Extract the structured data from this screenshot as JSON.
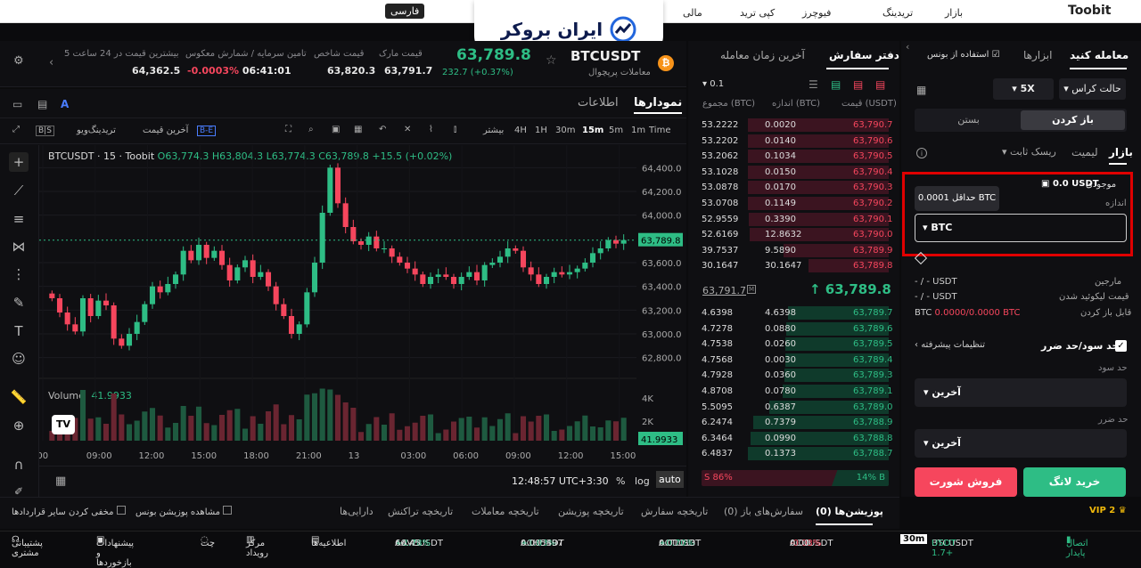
{
  "topnav": {
    "items": [
      "Toobit",
      "بازار",
      "تریدینگ",
      "فیوچرز",
      "کپی ترید",
      "مالی",
      "تبادل"
    ],
    "lang_badge": "فارسی"
  },
  "brand": {
    "name": "ایران بروکر"
  },
  "ticker": {
    "symbol": "BTCUSDT",
    "subtitle": "معاملات پرپچوال",
    "price": "63,789.8",
    "change": "232.7 (+0.37%)",
    "mark_label": "قیمت مارک",
    "mark_value": "63,791.7",
    "index_label": "قیمت شاخص",
    "index_value": "63,820.3",
    "funding_label": "تامین سرمایه / شمارش معکوس",
    "funding_rate": "-0.0003%",
    "funding_time": "06:41:01",
    "high_label": "بیشترین قیمت در 24 ساعت 5",
    "high_value": "64,362.5"
  },
  "chart_tabs": {
    "charts": "نمودارها",
    "info": "اطلاعات"
  },
  "chart_toolbar": {
    "timeframes": [
      "Time",
      "1m",
      "5m",
      "15m",
      "30m",
      "1H",
      "4H"
    ],
    "more": "بیشتر",
    "last_price": "آخرین قیمت",
    "tradingview": "تریدینگ‌ویو",
    "bs": "B|S",
    "be": "B-E"
  },
  "chart_legend": {
    "title": "BTCUSDT · 15 · Toobit",
    "o": "O63,774.3",
    "h": "H63,804.3",
    "l": "L63,774.3",
    "c": "C63,789.8",
    "chg": "+15.5 (+0.02%)",
    "volume_label": "Volume",
    "volume_value": "41.9933"
  },
  "chart_data": {
    "type": "candlestick",
    "y_ticks": [
      "64,400.0",
      "64,200.0",
      "64,000.0",
      "63,600.0",
      "63,400.0",
      "63,200.0",
      "63,000.0",
      "62,800.0"
    ],
    "x_ticks": [
      ":00",
      "09:00",
      "12:00",
      "15:00",
      "18:00",
      "21:00",
      "13",
      "03:00",
      "06:00",
      "09:00",
      "12:00",
      "15:00"
    ],
    "vol_ticks": [
      "4K",
      "2K"
    ],
    "last_price_tag": "63,789.8",
    "last_volume_tag": "41.9933",
    "closes": [
      63300,
      63180,
      63080,
      63020,
      63300,
      63150,
      63280,
      63240,
      62960,
      62900,
      63000,
      63100,
      63250,
      63400,
      63350,
      63420,
      63500,
      63700,
      63620,
      63750,
      63640,
      63700,
      63580,
      63450,
      63560,
      63620,
      63480,
      63520,
      63400,
      63250,
      63150,
      63000,
      63080,
      63350,
      63600,
      64020,
      64400,
      64100,
      63900,
      63780,
      63750,
      63820,
      63720,
      63720,
      63650,
      63600,
      63550,
      63500,
      63420,
      63480,
      63500,
      63480,
      63420,
      63480,
      63520,
      63450,
      63580,
      63600,
      63650,
      63720,
      63700,
      63560,
      63500,
      63420,
      63480,
      63520,
      63500,
      63520,
      63550,
      63600,
      63680,
      63720,
      63790,
      63760,
      63790
    ]
  },
  "chart_footer": {
    "clock": "12:48:57 UTC+3:30",
    "pct": "%",
    "log": "log",
    "auto": "auto"
  },
  "orderbook": {
    "tab_orderbook": "دفتر سفارش",
    "tab_trades": "آخرین زمان معامله",
    "precision": "0.1",
    "col_price": "قیمت (USDT)",
    "col_size": "اندازه (BTC)",
    "col_total": "مجموع (BTC)",
    "asks": [
      [
        "63,790.7",
        "0.0020",
        "53.2222"
      ],
      [
        "63,790.6",
        "0.0140",
        "53.2202"
      ],
      [
        "63,790.5",
        "0.1034",
        "53.2062"
      ],
      [
        "63,790.4",
        "0.0150",
        "53.1028"
      ],
      [
        "63,790.3",
        "0.0170",
        "53.0878"
      ],
      [
        "63,790.2",
        "0.1149",
        "53.0708"
      ],
      [
        "63,790.1",
        "0.3390",
        "52.9559"
      ],
      [
        "63,790.0",
        "12.8632",
        "52.6169"
      ],
      [
        "63,789.9",
        "9.5890",
        "39.7537"
      ],
      [
        "63,789.8",
        "30.1647",
        "30.1647"
      ]
    ],
    "mid_price": "63,789.8",
    "mid_mark": "63,791.7",
    "bids": [
      [
        "63,789.7",
        "4.6398",
        "4.6398"
      ],
      [
        "63,789.6",
        "0.0880",
        "4.7278"
      ],
      [
        "63,789.5",
        "0.0260",
        "4.7538"
      ],
      [
        "63,789.4",
        "0.0030",
        "4.7568"
      ],
      [
        "63,789.3",
        "0.0360",
        "4.7928"
      ],
      [
        "63,789.1",
        "0.0780",
        "4.8708"
      ],
      [
        "63,789.0",
        "0.6387",
        "5.5095"
      ],
      [
        "63,788.9",
        "0.7379",
        "6.2474"
      ],
      [
        "63,788.8",
        "0.0990",
        "6.3464"
      ],
      [
        "63,788.7",
        "0.1373",
        "6.4837"
      ]
    ],
    "ratio_buy": "14% B",
    "ratio_sell": "S 86%"
  },
  "trade_panel": {
    "tab_trade": "معامله کنید",
    "tab_tools": "ابزارها",
    "bonus": "استفاده از بونس",
    "margin_mode": "حالت کراس",
    "leverage": "5X",
    "open_btn": "باز کردن",
    "close_btn": "بستن",
    "order_market": "بازار",
    "order_limit": "لیمیت",
    "order_stop": "ریسک ثابت",
    "available_label": "موجودی",
    "available_value": "0.0 USDT",
    "size_label": "اندازه",
    "min_hint": "حداقل 0.0001 BTC",
    "size_unit": "BTC",
    "margin_label": "مارجین",
    "margin_value": "- / - USDT",
    "liq_label": "قیمت لیکوئید شدن",
    "liq_value": "- / - USDT",
    "openable_label": "قابل باز کردن",
    "openable_value": "0.0000/0.0000 BTC",
    "tpsl_label": "حد سود/حد ضرر",
    "advanced": "تنظیمات پیشرفته",
    "tp_label": "حد سود",
    "tp_type": "آخرین",
    "sl_label": "حد ضرر",
    "sl_type": "آخرین",
    "buy_long": "خرید لانگ",
    "sell_short": "فروش شورت",
    "vip": "VIP 2"
  },
  "bottom_tabs": [
    "پوزیشن‌ها (0)",
    "سفارش‌های باز (0)",
    "تاریخچه سفارش",
    "تاریخچه پوزیشن",
    "تاریخچه معاملات",
    "تاریخچه تراکنش",
    "دارایی‌ها"
  ],
  "bottom_checks": {
    "show_bonus": "مشاهده پوزیشن بونس",
    "hide_others": "مخفی کردن سایر قراردادها"
  },
  "footer": {
    "connection": "اتصال پایدار",
    "items": [
      {
        "sym": "BTCUSDT",
        "chg": "",
        "price": "USDT 1.7+"
      },
      {
        "sym": "ACUUSDT",
        "chg": "-0.03%",
        "price": "0.00"
      },
      {
        "sym": "ACTUSDT",
        "chg": "+0.70%",
        "price": "0.01013"
      },
      {
        "sym": "ACHUSDT",
        "chg": "+1.03%",
        "price": "0.005497"
      },
      {
        "sym": "AAVEUSDT",
        "chg": "+2.78%",
        "price": "66.45"
      }
    ],
    "tf_badge": "30m",
    "announcements": "اطلاعیه‌ها",
    "events": "مرکز رویداد",
    "chat": "چت",
    "feedback": "پیشنهادات و بازخوردها",
    "support": "پشتیبانی مشتری"
  },
  "colors": {
    "up": "#2ebd85",
    "down": "#f6465d",
    "accent": "#f0b90b",
    "highlight": "#e00000"
  }
}
